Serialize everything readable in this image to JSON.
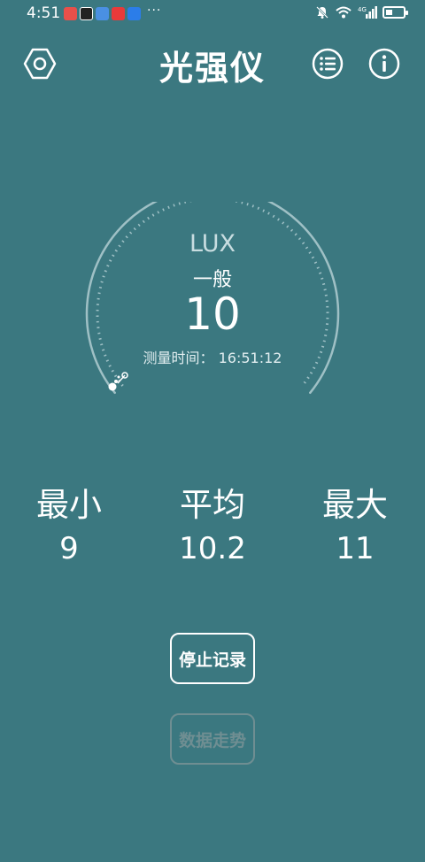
{
  "status_bar": {
    "time": "4:51",
    "more": "···",
    "network": "4G"
  },
  "header": {
    "title": "光强仪"
  },
  "gauge": {
    "unit": "LUX",
    "level": "一般",
    "value": "10",
    "time_label": "测量时间：",
    "time_value": "16:51:12"
  },
  "stats": {
    "min": {
      "label": "最小",
      "value": "9"
    },
    "avg": {
      "label": "平均",
      "value": "10.2"
    },
    "max": {
      "label": "最大",
      "value": "11"
    }
  },
  "buttons": {
    "stop": "停止记录",
    "trend": "数据走势"
  },
  "colors": {
    "background": "#3b7880",
    "disabled": "#6f8e92",
    "foreground": "#ffffff"
  },
  "icons": {
    "settings": "settings-hexagon-icon",
    "list": "list-icon",
    "info": "info-icon"
  }
}
